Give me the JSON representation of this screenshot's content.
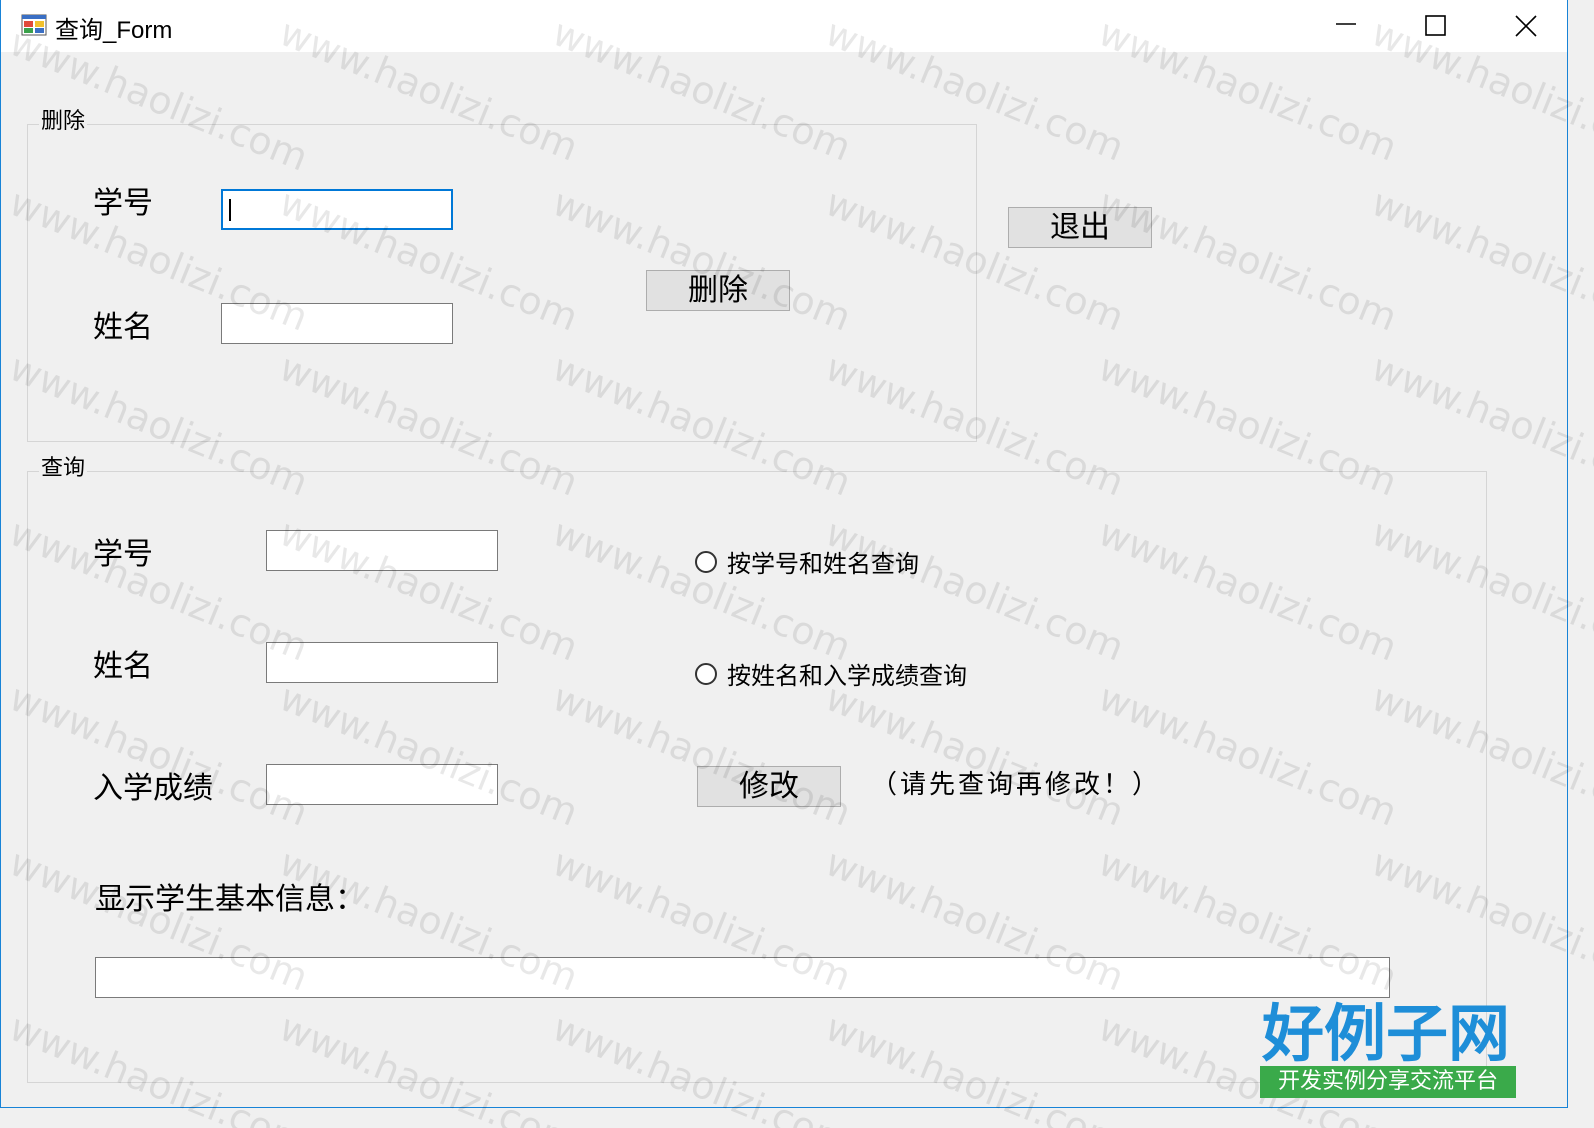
{
  "window": {
    "title": "查询_Form"
  },
  "delete_group": {
    "title": "删除",
    "student_id_label": "学号",
    "student_id_value": "",
    "name_label": "姓名",
    "name_value": "",
    "delete_button": "删除"
  },
  "exit_button": "退出",
  "query_group": {
    "title": "查询",
    "student_id_label": "学号",
    "student_id_value": "",
    "name_label": "姓名",
    "name_value": "",
    "score_label": "入学成绩",
    "score_value": "",
    "radio_by_id_name": "按学号和姓名查询",
    "radio_by_name_score": "按姓名和入学成绩查询",
    "modify_button": "修改",
    "hint": "（请先查询再修改！）",
    "info_label": "显示学生基本信息：",
    "info_value": ""
  },
  "watermark": {
    "text": "www.haolizi.com"
  },
  "logo": {
    "main": "好例子网",
    "sub": "开发实例分享交流平台"
  }
}
